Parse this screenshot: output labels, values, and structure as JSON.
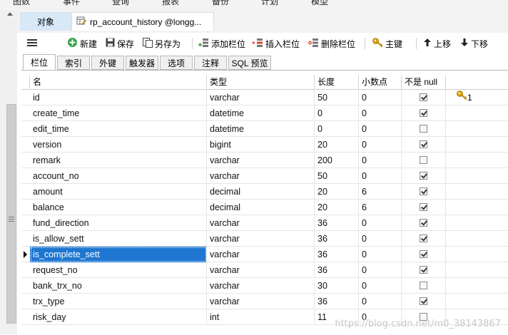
{
  "menu": [
    "图数",
    "事件",
    "查询",
    "报表",
    "备份",
    "计划",
    "模型"
  ],
  "tabs": {
    "objects": "对象",
    "document": "rp_account_history @longg..."
  },
  "toolbar": {
    "new": "新建",
    "save": "保存",
    "save_as": "另存为",
    "add_field": "添加栏位",
    "insert_field": "插入栏位",
    "delete_field": "删除栏位",
    "primary_key": "主键",
    "move_up": "上移",
    "move_down": "下移"
  },
  "subtabs": [
    "栏位",
    "索引",
    "外键",
    "触发器",
    "选项",
    "注释",
    "SQL 预览"
  ],
  "columns": {
    "name": "名",
    "type": "类型",
    "length": "长度",
    "decimals": "小数点",
    "not_null": "不是 null"
  },
  "rows": [
    {
      "name": "id",
      "type": "varchar",
      "length": "50",
      "decimals": "0",
      "not_null": true,
      "key": "1"
    },
    {
      "name": "create_time",
      "type": "datetime",
      "length": "0",
      "decimals": "0",
      "not_null": true,
      "key": ""
    },
    {
      "name": "edit_time",
      "type": "datetime",
      "length": "0",
      "decimals": "0",
      "not_null": false,
      "key": ""
    },
    {
      "name": "version",
      "type": "bigint",
      "length": "20",
      "decimals": "0",
      "not_null": true,
      "key": ""
    },
    {
      "name": "remark",
      "type": "varchar",
      "length": "200",
      "decimals": "0",
      "not_null": false,
      "key": ""
    },
    {
      "name": "account_no",
      "type": "varchar",
      "length": "50",
      "decimals": "0",
      "not_null": true,
      "key": ""
    },
    {
      "name": "amount",
      "type": "decimal",
      "length": "20",
      "decimals": "6",
      "not_null": true,
      "key": ""
    },
    {
      "name": "balance",
      "type": "decimal",
      "length": "20",
      "decimals": "6",
      "not_null": true,
      "key": ""
    },
    {
      "name": "fund_direction",
      "type": "varchar",
      "length": "36",
      "decimals": "0",
      "not_null": true,
      "key": ""
    },
    {
      "name": "is_allow_sett",
      "type": "varchar",
      "length": "36",
      "decimals": "0",
      "not_null": true,
      "key": ""
    },
    {
      "name": "is_complete_sett",
      "type": "varchar",
      "length": "36",
      "decimals": "0",
      "not_null": true,
      "key": "",
      "selected": true
    },
    {
      "name": "request_no",
      "type": "varchar",
      "length": "36",
      "decimals": "0",
      "not_null": true,
      "key": ""
    },
    {
      "name": "bank_trx_no",
      "type": "varchar",
      "length": "30",
      "decimals": "0",
      "not_null": false,
      "key": ""
    },
    {
      "name": "trx_type",
      "type": "varchar",
      "length": "36",
      "decimals": "0",
      "not_null": true,
      "key": ""
    },
    {
      "name": "risk_day",
      "type": "int",
      "length": "11",
      "decimals": "0",
      "not_null": false,
      "key": ""
    }
  ],
  "watermark": "https://blog.csdn.net/m0_38143867",
  "colors": {
    "selection": "#1e76d0",
    "active_tab": "#d7e8f7",
    "key_icon": "#e5a800"
  }
}
